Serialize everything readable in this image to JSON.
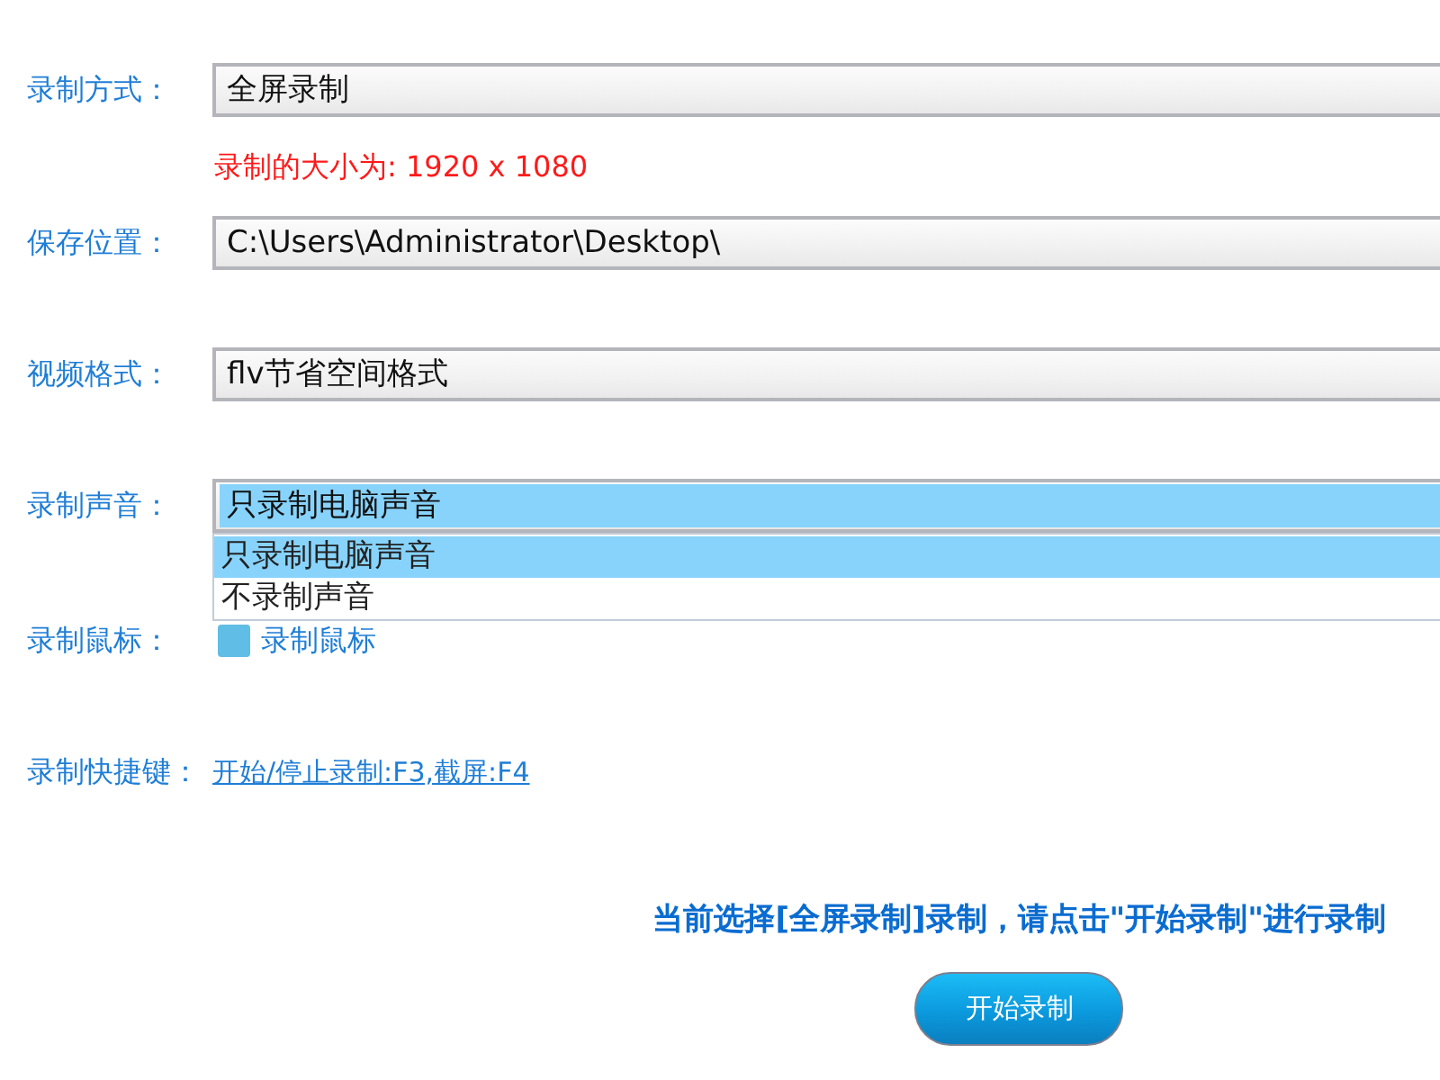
{
  "rows": [
    {
      "kind": "select",
      "label": "录制方式：",
      "value": "全屏录制",
      "expanded": false,
      "note": "录制的大小为: 1920 x 1080"
    },
    {
      "kind": "input",
      "label": "保存位置：",
      "value": "C:\\Users\\Administrator\\Desktop\\"
    },
    {
      "kind": "select",
      "label": "视频格式：",
      "value": "flv节省空间格式",
      "expanded": false
    },
    {
      "kind": "select",
      "label": "录制声音：",
      "value": "只录制电脑声音",
      "expanded": true,
      "options": [
        {
          "label": "只录制电脑声音",
          "selected": true
        },
        {
          "label": "不录制声音",
          "selected": false
        }
      ]
    },
    {
      "kind": "checkbox",
      "label": "录制鼠标：",
      "text": "录制鼠标",
      "checked": true
    },
    {
      "kind": "link",
      "label": "录制快捷键：",
      "text": "开始/停止录制:F3,截屏:F4"
    }
  ],
  "message": "当前选择[全屏录制]录制，请点击\"开始录制\"进行录制",
  "start_button": "开始录制"
}
